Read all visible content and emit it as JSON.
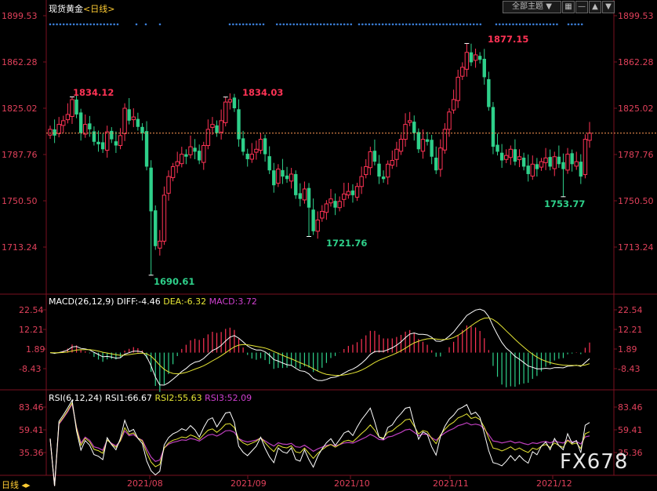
{
  "header": {
    "title": "现货黄金",
    "period": "<日线>",
    "theme_button": "全部主题",
    "dropdown_icon": "chevron-down-icon",
    "toolbar_icons": [
      "grid-icon",
      "minus-icon",
      "up-icon",
      "down-icon"
    ],
    "period_tab": "日线"
  },
  "colors": {
    "up": "#ff3355",
    "down": "#2ed08a",
    "dif": "#ffffff",
    "dea": "#e6e635",
    "rsi3": "#c040c0",
    "axis": "#e0405a",
    "last": "#ff9955"
  },
  "price_axis": {
    "ticks": [
      "1899.53",
      "1862.28",
      "1825.02",
      "1787.76",
      "1750.50",
      "1713.24"
    ]
  },
  "macd_axis": {
    "ticks": [
      "22.54",
      "12.21",
      "1.89",
      "-8.43"
    ]
  },
  "rsi_axis": {
    "ticks": [
      "83.46",
      "59.41",
      "35.36"
    ]
  },
  "x_axis": {
    "ticks": [
      "2021/08",
      "2021/09",
      "2021/10",
      "2021/11",
      "2021/12"
    ]
  },
  "macd_legend": {
    "title": "MACD(26,12,9)",
    "dif": "DIFF:-4.46",
    "dea": "DEA:-6.32",
    "macd": "MACD:3.72"
  },
  "rsi_legend": {
    "title": "RSI(6,12,24)",
    "rsi1": "RSI1:66.67",
    "rsi2": "RSI2:55.63",
    "rsi3": "RSI3:52.09"
  },
  "annotations": {
    "h1": "1834.12",
    "l1": "1690.61",
    "h2": "1834.03",
    "l2": "1721.76",
    "h3": "1877.15",
    "l3": "1753.77"
  },
  "watermark": "FX678",
  "chart_data": {
    "type": "candlestick",
    "symbol": "现货黄金",
    "period": "日线",
    "annotated_points": [
      {
        "label": "1834.12",
        "value": 1834.12,
        "kind": "high"
      },
      {
        "label": "1690.61",
        "value": 1690.61,
        "kind": "low"
      },
      {
        "label": "1834.03",
        "value": 1834.03,
        "kind": "high"
      },
      {
        "label": "1721.76",
        "value": 1721.76,
        "kind": "low"
      },
      {
        "label": "1877.15",
        "value": 1877.15,
        "kind": "high"
      },
      {
        "label": "1753.77",
        "value": 1753.77,
        "kind": "low"
      }
    ],
    "close_path": [
      1808,
      1803,
      1812,
      1815,
      1820,
      1832,
      1820,
      1805,
      1812,
      1808,
      1798,
      1796,
      1792,
      1806,
      1800,
      1795,
      1803,
      1825,
      1815,
      1818,
      1810,
      1805,
      1778,
      1742,
      1714,
      1718,
      1755,
      1770,
      1778,
      1782,
      1788,
      1786,
      1794,
      1790,
      1783,
      1795,
      1808,
      1812,
      1805,
      1815,
      1830,
      1832,
      1825,
      1800,
      1790,
      1784,
      1788,
      1792,
      1800,
      1788,
      1775,
      1763,
      1776,
      1770,
      1768,
      1772,
      1755,
      1752,
      1760,
      1745,
      1726,
      1735,
      1742,
      1748,
      1752,
      1745,
      1750,
      1756,
      1758,
      1755,
      1762,
      1770,
      1778,
      1790,
      1782,
      1770,
      1768,
      1780,
      1783,
      1792,
      1800,
      1812,
      1815,
      1805,
      1792,
      1800,
      1798,
      1786,
      1775,
      1793,
      1808,
      1822,
      1832,
      1850,
      1858,
      1870,
      1862,
      1868,
      1864,
      1850,
      1826,
      1794,
      1790,
      1783,
      1787,
      1792,
      1782,
      1786,
      1778,
      1772,
      1780,
      1776,
      1782,
      1785,
      1778,
      1786,
      1780,
      1776,
      1788,
      1780,
      1782,
      1770,
      1800,
      1805
    ],
    "macd_dif_last": -4.46,
    "macd_dea_last": -6.32,
    "macd_last": 3.72,
    "rsi1_last": 66.67,
    "rsi2_last": 55.63,
    "rsi3_last": 52.09,
    "last_price_line": 1805
  }
}
